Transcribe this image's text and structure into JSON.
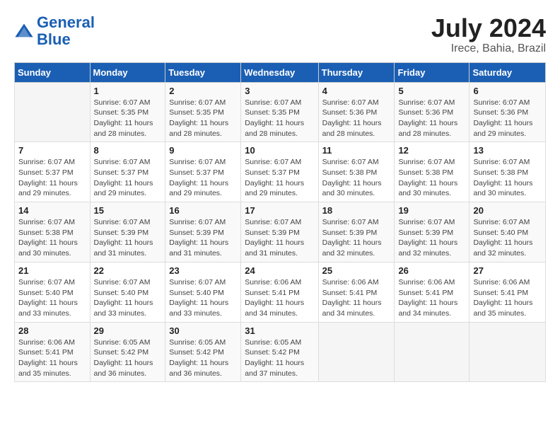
{
  "logo": {
    "line1": "General",
    "line2": "Blue"
  },
  "title": "July 2024",
  "location": "Irece, Bahia, Brazil",
  "days_of_week": [
    "Sunday",
    "Monday",
    "Tuesday",
    "Wednesday",
    "Thursday",
    "Friday",
    "Saturday"
  ],
  "weeks": [
    [
      {
        "day": "",
        "info": ""
      },
      {
        "day": "1",
        "info": "Sunrise: 6:07 AM\nSunset: 5:35 PM\nDaylight: 11 hours\nand 28 minutes."
      },
      {
        "day": "2",
        "info": "Sunrise: 6:07 AM\nSunset: 5:35 PM\nDaylight: 11 hours\nand 28 minutes."
      },
      {
        "day": "3",
        "info": "Sunrise: 6:07 AM\nSunset: 5:35 PM\nDaylight: 11 hours\nand 28 minutes."
      },
      {
        "day": "4",
        "info": "Sunrise: 6:07 AM\nSunset: 5:36 PM\nDaylight: 11 hours\nand 28 minutes."
      },
      {
        "day": "5",
        "info": "Sunrise: 6:07 AM\nSunset: 5:36 PM\nDaylight: 11 hours\nand 28 minutes."
      },
      {
        "day": "6",
        "info": "Sunrise: 6:07 AM\nSunset: 5:36 PM\nDaylight: 11 hours\nand 29 minutes."
      }
    ],
    [
      {
        "day": "7",
        "info": "Sunrise: 6:07 AM\nSunset: 5:37 PM\nDaylight: 11 hours\nand 29 minutes."
      },
      {
        "day": "8",
        "info": "Sunrise: 6:07 AM\nSunset: 5:37 PM\nDaylight: 11 hours\nand 29 minutes."
      },
      {
        "day": "9",
        "info": "Sunrise: 6:07 AM\nSunset: 5:37 PM\nDaylight: 11 hours\nand 29 minutes."
      },
      {
        "day": "10",
        "info": "Sunrise: 6:07 AM\nSunset: 5:37 PM\nDaylight: 11 hours\nand 29 minutes."
      },
      {
        "day": "11",
        "info": "Sunrise: 6:07 AM\nSunset: 5:38 PM\nDaylight: 11 hours\nand 30 minutes."
      },
      {
        "day": "12",
        "info": "Sunrise: 6:07 AM\nSunset: 5:38 PM\nDaylight: 11 hours\nand 30 minutes."
      },
      {
        "day": "13",
        "info": "Sunrise: 6:07 AM\nSunset: 5:38 PM\nDaylight: 11 hours\nand 30 minutes."
      }
    ],
    [
      {
        "day": "14",
        "info": "Sunrise: 6:07 AM\nSunset: 5:38 PM\nDaylight: 11 hours\nand 30 minutes."
      },
      {
        "day": "15",
        "info": "Sunrise: 6:07 AM\nSunset: 5:39 PM\nDaylight: 11 hours\nand 31 minutes."
      },
      {
        "day": "16",
        "info": "Sunrise: 6:07 AM\nSunset: 5:39 PM\nDaylight: 11 hours\nand 31 minutes."
      },
      {
        "day": "17",
        "info": "Sunrise: 6:07 AM\nSunset: 5:39 PM\nDaylight: 11 hours\nand 31 minutes."
      },
      {
        "day": "18",
        "info": "Sunrise: 6:07 AM\nSunset: 5:39 PM\nDaylight: 11 hours\nand 32 minutes."
      },
      {
        "day": "19",
        "info": "Sunrise: 6:07 AM\nSunset: 5:39 PM\nDaylight: 11 hours\nand 32 minutes."
      },
      {
        "day": "20",
        "info": "Sunrise: 6:07 AM\nSunset: 5:40 PM\nDaylight: 11 hours\nand 32 minutes."
      }
    ],
    [
      {
        "day": "21",
        "info": "Sunrise: 6:07 AM\nSunset: 5:40 PM\nDaylight: 11 hours\nand 33 minutes."
      },
      {
        "day": "22",
        "info": "Sunrise: 6:07 AM\nSunset: 5:40 PM\nDaylight: 11 hours\nand 33 minutes."
      },
      {
        "day": "23",
        "info": "Sunrise: 6:07 AM\nSunset: 5:40 PM\nDaylight: 11 hours\nand 33 minutes."
      },
      {
        "day": "24",
        "info": "Sunrise: 6:06 AM\nSunset: 5:41 PM\nDaylight: 11 hours\nand 34 minutes."
      },
      {
        "day": "25",
        "info": "Sunrise: 6:06 AM\nSunset: 5:41 PM\nDaylight: 11 hours\nand 34 minutes."
      },
      {
        "day": "26",
        "info": "Sunrise: 6:06 AM\nSunset: 5:41 PM\nDaylight: 11 hours\nand 34 minutes."
      },
      {
        "day": "27",
        "info": "Sunrise: 6:06 AM\nSunset: 5:41 PM\nDaylight: 11 hours\nand 35 minutes."
      }
    ],
    [
      {
        "day": "28",
        "info": "Sunrise: 6:06 AM\nSunset: 5:41 PM\nDaylight: 11 hours\nand 35 minutes."
      },
      {
        "day": "29",
        "info": "Sunrise: 6:05 AM\nSunset: 5:42 PM\nDaylight: 11 hours\nand 36 minutes."
      },
      {
        "day": "30",
        "info": "Sunrise: 6:05 AM\nSunset: 5:42 PM\nDaylight: 11 hours\nand 36 minutes."
      },
      {
        "day": "31",
        "info": "Sunrise: 6:05 AM\nSunset: 5:42 PM\nDaylight: 11 hours\nand 37 minutes."
      },
      {
        "day": "",
        "info": ""
      },
      {
        "day": "",
        "info": ""
      },
      {
        "day": "",
        "info": ""
      }
    ]
  ]
}
